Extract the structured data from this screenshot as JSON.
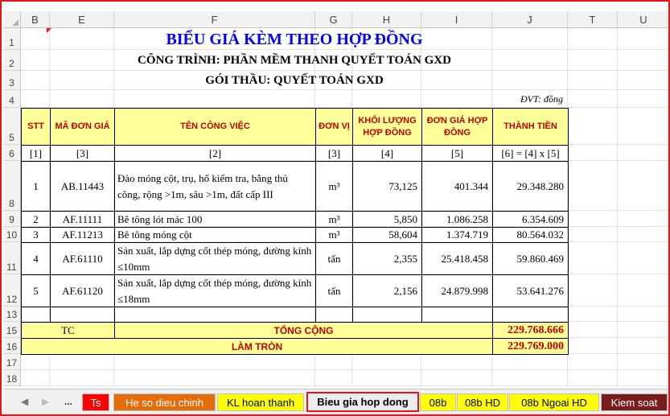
{
  "columns": [
    "B",
    "E",
    "F",
    "G",
    "H",
    "I",
    "J",
    "T",
    "U"
  ],
  "rows": [
    "1",
    "2",
    "3",
    "4",
    "5",
    "6",
    "8",
    "9",
    "10",
    "11",
    "12",
    "13",
    "15",
    "16",
    "17",
    "18"
  ],
  "title": "BIỂU GIÁ KÈM THEO HỢP ĐỒNG",
  "project": "CÔNG TRÌNH: PHẦN MỀM THANH QUYẾT TOÁN GXD",
  "package": "GÓI THẦU: QUYẾT TOÁN GXD",
  "unit_note": "ĐVT: đồng",
  "headers": [
    "STT",
    "MÃ ĐƠN GIÁ",
    "TÊN CÔNG VIỆC",
    "ĐƠN VỊ",
    "KHỐI LƯỢNG HỢP ĐỒNG",
    "ĐƠN GIÁ HỢP ĐỒNG",
    "THÀNH TIỀN"
  ],
  "index_row": [
    "[1]",
    "[3]",
    "[2]",
    "[3]",
    "[4]",
    "[5]",
    "[6] = [4] x [5]"
  ],
  "items": [
    {
      "stt": "1",
      "code": "AB.11443",
      "name": "Đào móng cột, trụ, hố kiểm tra, bằng thủ công, rộng >1m, sâu >1m, đất cấp III",
      "unit": "m³",
      "qty": "73,125",
      "price": "401.344",
      "total": "29.348.280"
    },
    {
      "stt": "2",
      "code": "AF.11111",
      "name": "Bê tông lót mác 100",
      "unit": "m³",
      "qty": "5,850",
      "price": "1.086.258",
      "total": "6.354.609"
    },
    {
      "stt": "3",
      "code": "AF.11213",
      "name": "Bê tông móng cột",
      "unit": "m³",
      "qty": "58,604",
      "price": "1.374.719",
      "total": "80.564.032"
    },
    {
      "stt": "4",
      "code": "AF.61110",
      "name": "Sản xuất, lắp dựng cốt thép móng, đường kính ≤10mm",
      "unit": "tấn",
      "qty": "2,355",
      "price": "25.418.458",
      "total": "59.860.469"
    },
    {
      "stt": "5",
      "code": "AF.61120",
      "name": "Sản xuất, lắp dựng cốt thép móng, đường kính ≤18mm",
      "unit": "tấn",
      "qty": "2,156",
      "price": "24.879.998",
      "total": "53.641.276"
    }
  ],
  "total_row": {
    "code": "TC",
    "label": "TỔNG CỘNG",
    "value": "229.768.666"
  },
  "round_row": {
    "label": "LÀM TRÒN",
    "value": "229.769.000"
  },
  "tabs": {
    "ellipsis": "...",
    "items": [
      {
        "label": "Ts",
        "bg": "#ff0000",
        "fg": "#ffffff"
      },
      {
        "label": "He so dieu chinh",
        "bg": "#e46c0a",
        "fg": "#ffffff"
      },
      {
        "label": "KL hoan thanh",
        "bg": "#ffff00",
        "fg": "#000000"
      },
      {
        "label": "Bieu gia hop dong",
        "bg": "#e9e9e9",
        "fg": "#000000",
        "active": true
      },
      {
        "label": "08b",
        "bg": "#ffff00",
        "fg": "#000000"
      },
      {
        "label": "08b HD",
        "bg": "#ffff00",
        "fg": "#000000"
      },
      {
        "label": "08b Ngoai HD",
        "bg": "#ffff00",
        "fg": "#000000"
      },
      {
        "label": "Kiem soat",
        "bg": "#7b1c1c",
        "fg": "#ffffff"
      }
    ]
  }
}
